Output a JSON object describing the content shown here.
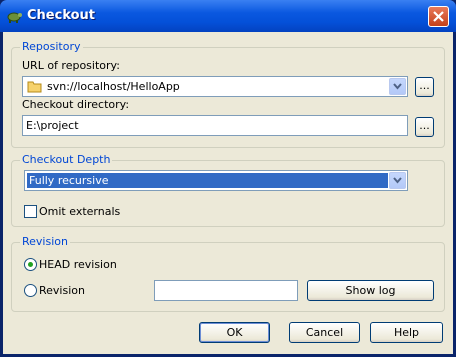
{
  "window": {
    "title": "Checkout"
  },
  "repository": {
    "legend": "Repository",
    "url_label": "URL of repository:",
    "url_value": "svn://localhost/HelloApp",
    "browse_label": "...",
    "dir_label": "Checkout directory:",
    "dir_value": "E:\\project",
    "dir_browse_label": "..."
  },
  "depth": {
    "legend": "Checkout Depth",
    "selected": "Fully recursive",
    "omit_externals_label": "Omit externals",
    "omit_externals_checked": false
  },
  "revision": {
    "legend": "Revision",
    "head_label": "HEAD revision",
    "revision_label": "Revision",
    "selected": "head",
    "revision_value": "",
    "show_log_label": "Show log"
  },
  "buttons": {
    "ok": "OK",
    "cancel": "Cancel",
    "help": "Help"
  },
  "colors": {
    "selection": "#316ac5",
    "legend": "#0046d5",
    "titlebar": "#0a58e0"
  }
}
